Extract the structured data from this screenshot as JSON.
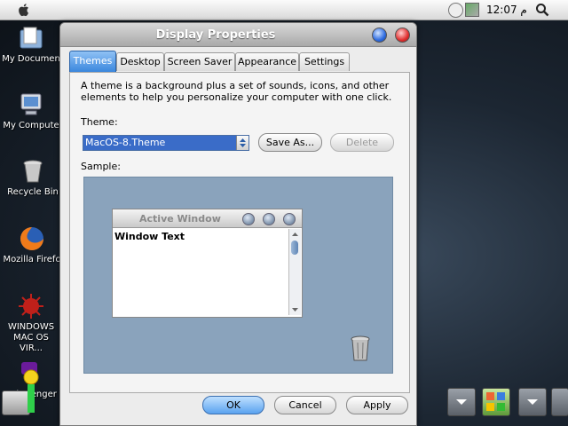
{
  "menubar": {
    "clock": "12:07 م",
    "icons": [
      "apple-icon",
      "smiley-icon",
      "network-icon",
      "search-icon"
    ]
  },
  "desktop": {
    "icons": [
      {
        "label": "My Documen",
        "icon": "documents-folder-icon"
      },
      {
        "label": "My Compute",
        "icon": "computer-icon"
      },
      {
        "label": "Recycle Bin",
        "icon": "recycle-bin-icon"
      },
      {
        "label": "Mozilla Firefo",
        "icon": "firefox-icon"
      },
      {
        "label": "WINDOWS MAC OS VIR...",
        "icon": "virus-icon"
      },
      {
        "label": "ool ssenger",
        "icon": "yahoo-messenger-icon"
      }
    ]
  },
  "dialog": {
    "title": "Display Properties",
    "tabs": [
      "Themes",
      "Desktop",
      "Screen Saver",
      "Appearance",
      "Settings"
    ],
    "active_tab": "Themes",
    "description": "A theme is a background plus a set of sounds, icons, and other elements to help you personalize your computer with one click.",
    "theme_label": "Theme:",
    "theme_value": "MacOS-8.Theme",
    "save_as": "Save As...",
    "delete": "Delete",
    "sample_label": "Sample:",
    "sample": {
      "window_title": "Active Window",
      "window_text": "Window Text"
    },
    "ok": "OK",
    "cancel": "Cancel",
    "apply": "Apply"
  },
  "colors": {
    "accent": "#3b87dd",
    "selection": "#3a6cc8",
    "sample_bg": "#8aa3bc"
  }
}
